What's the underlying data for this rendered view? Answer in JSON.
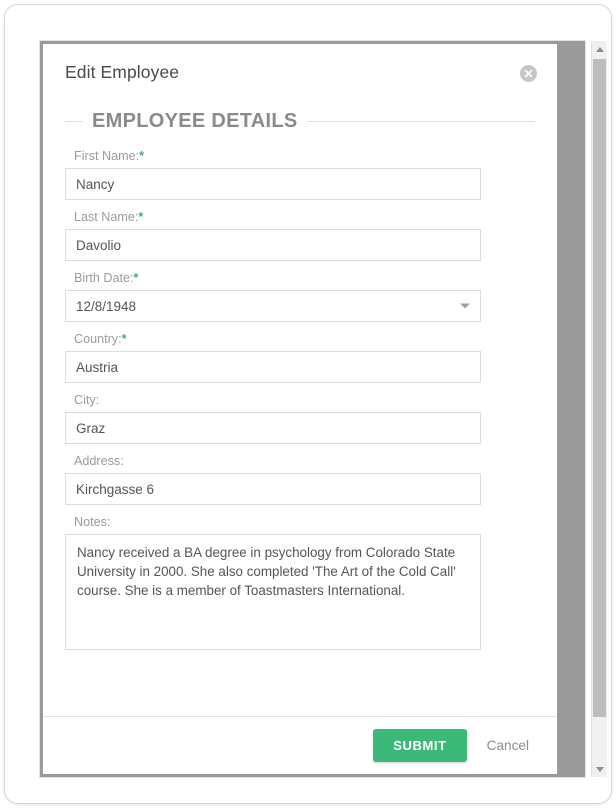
{
  "dialog": {
    "title": "Edit Employee",
    "close_icon": "close-icon",
    "section_title": "EMPLOYEE DETAILS",
    "required_marker": "*"
  },
  "fields": {
    "first_name": {
      "label": "First Name:",
      "value": "Nancy",
      "required": true
    },
    "last_name": {
      "label": "Last Name:",
      "value": "Davolio",
      "required": true
    },
    "birth_date": {
      "label": "Birth Date:",
      "value": "12/8/1948",
      "required": true
    },
    "country": {
      "label": "Country:",
      "value": "Austria",
      "required": true
    },
    "city": {
      "label": "City:",
      "value": "Graz",
      "required": false
    },
    "address": {
      "label": "Address:",
      "value": "Kirchgasse 6",
      "required": false
    },
    "notes": {
      "label": "Notes:",
      "value": "Nancy received a BA degree in psychology from Colorado State University in 2000. She also completed 'The Art of the Cold Call' course. She is a member of Toastmasters International."
    }
  },
  "footer": {
    "submit_label": "SUBMIT",
    "cancel_label": "Cancel"
  },
  "colors": {
    "accent_green": "#3cb878",
    "required_green": "#3fb46b",
    "label_gray": "#9b9b9b",
    "frame_gray": "#9a9a9a",
    "border_gray": "#dcdcdc"
  }
}
